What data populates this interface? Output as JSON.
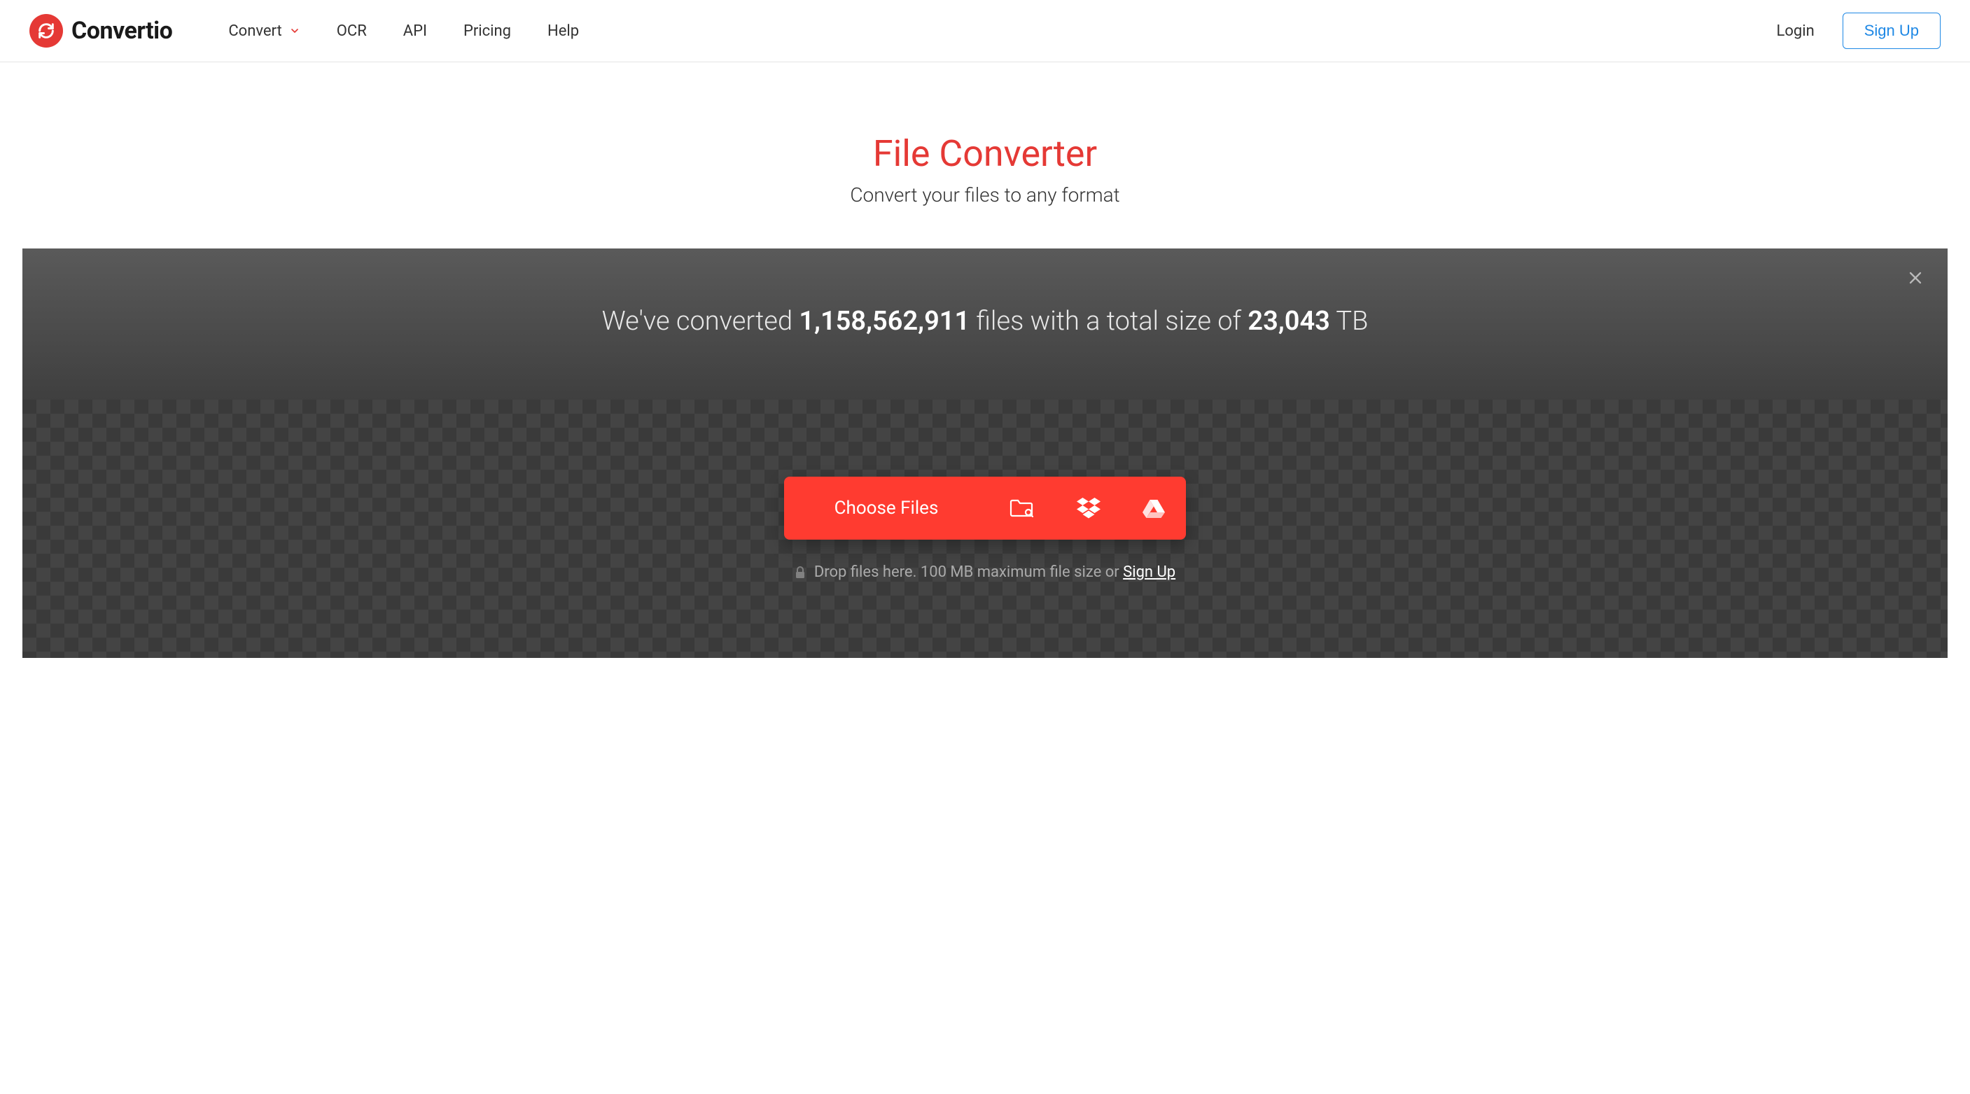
{
  "header": {
    "brand": "Convertio",
    "nav": {
      "convert": "Convert",
      "ocr": "OCR",
      "api": "API",
      "pricing": "Pricing",
      "help": "Help"
    },
    "login": "Login",
    "signup": "Sign Up"
  },
  "main": {
    "title": "File Converter",
    "subtitle": "Convert your files to any format"
  },
  "stats": {
    "prefix": "We've converted ",
    "files_count": "1,158,562,911",
    "middle": " files with a total size of ",
    "size": "23,043",
    "unit": " TB"
  },
  "dropzone": {
    "choose_files": "Choose Files",
    "hint_prefix": "Drop files here. 100 MB maximum file size or ",
    "signup_link": "Sign Up"
  }
}
